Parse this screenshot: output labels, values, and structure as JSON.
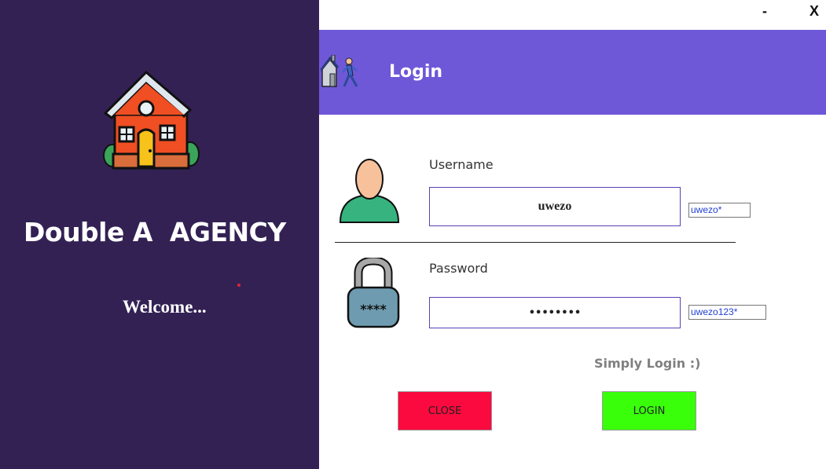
{
  "brand": {
    "title": "Double A  AGENCY",
    "welcome": "Welcome..."
  },
  "window": {
    "minimize": "-",
    "close": "X"
  },
  "header": {
    "title": "Login"
  },
  "form": {
    "username_label": "Username",
    "username_value": "uwezo",
    "username_hint": "uwezo*",
    "password_label": "Password",
    "password_value": "••••••••",
    "password_hint": "uwezo123*",
    "tagline": "Simply Login :)"
  },
  "buttons": {
    "close": "CLOSE",
    "login": "LOGIN"
  },
  "colors": {
    "sidebar": "#332154",
    "header": "#6e58d8",
    "close_button": "#fa0a3e",
    "login_button": "#39ff0b"
  },
  "icons": [
    "house-icon",
    "header-home-person-icon",
    "user-avatar-icon",
    "padlock-icon"
  ]
}
